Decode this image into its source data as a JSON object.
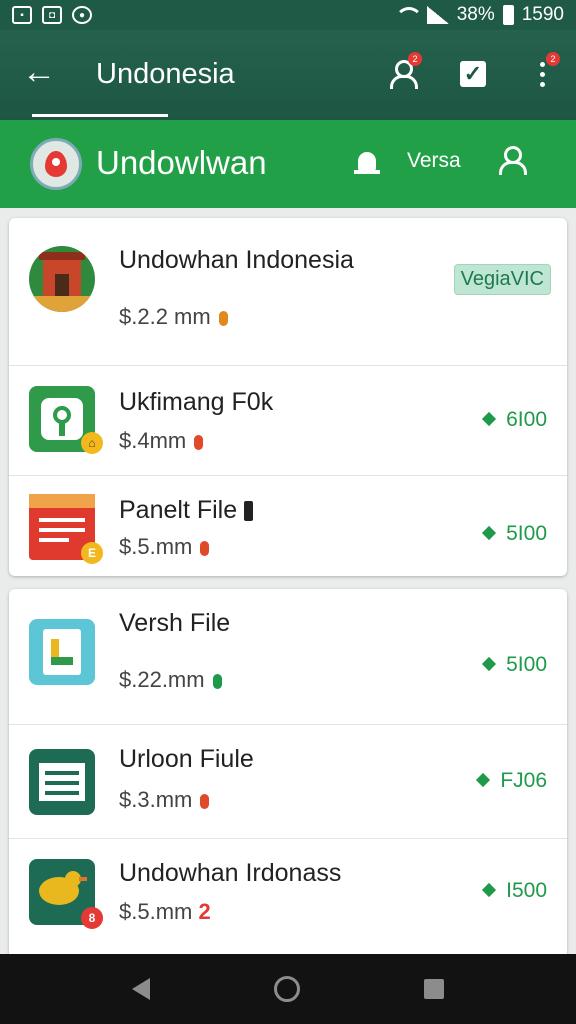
{
  "status_bar": {
    "battery": "38%",
    "time": "1590",
    "icons": [
      "gallery-icon",
      "photo-icon",
      "notification-icon",
      "wifi-icon",
      "signal-icon",
      "battery-icon"
    ]
  },
  "app_bar": {
    "title": "Undonesia",
    "icons": [
      "back-arrow-icon",
      "add-person-icon",
      "checkbox-icon",
      "more-vert-icon"
    ],
    "badge_count": "2"
  },
  "sub_bar": {
    "title": "Undowlwan",
    "action_label": "Versa"
  },
  "items": [
    {
      "name": "Undowhan Indonesia",
      "price": "$.2.2 mm",
      "tag": "VegiaVIC",
      "coin_color": "#e08a1e",
      "thumb": "temple"
    },
    {
      "name": "Ukfimang F0k",
      "price": "$.4mm",
      "value": "6I00",
      "coin_color": "#e04a2a",
      "thumb": "plug"
    },
    {
      "name": "Panelt File",
      "price": "$.5.mm",
      "value": "5I00",
      "coin_color": "#e04a2a",
      "thumb": "doc"
    },
    {
      "name": "Versh File",
      "price": "$.22.mm",
      "value": "5I00",
      "coin_color": "#1e9a4a",
      "thumb": "file"
    },
    {
      "name": "Urloon Fiule",
      "price": "$.3.mm",
      "value": "FJ06",
      "coin_color": "#e04a2a",
      "thumb": "slides"
    },
    {
      "name": "Undowhan Irdonass",
      "price": "$.5.mm",
      "price_suffix": "2",
      "value": "I500",
      "coin_color": "#e53935",
      "thumb": "bird"
    }
  ],
  "colors": {
    "app_bar": "#1d5744",
    "sub_bar": "#22a047",
    "accent_green": "#1e9a4a"
  }
}
